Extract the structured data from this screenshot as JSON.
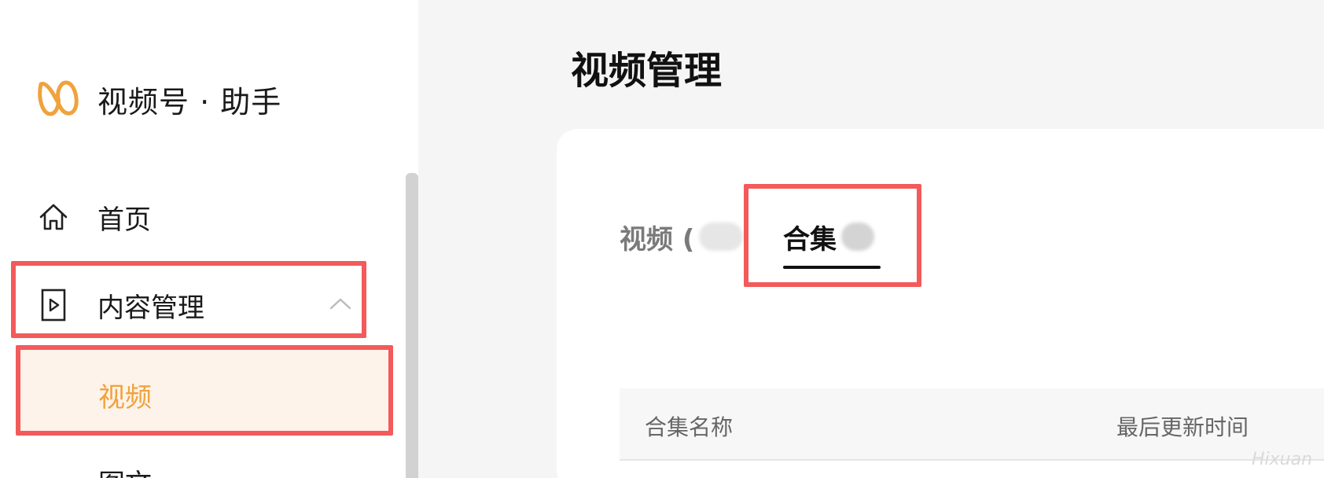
{
  "sidebar": {
    "logo_text": "视频号 · 助手",
    "logo_icon": "channels-logo-icon",
    "accent_color": "#f0a23d",
    "items": [
      {
        "label": "首页",
        "icon": "home-icon"
      },
      {
        "label": "内容管理",
        "icon": "play-document-icon",
        "expanded": true
      },
      {
        "label": "视频",
        "active": true
      },
      {
        "label": "图文"
      }
    ]
  },
  "main": {
    "page_title": "视频管理",
    "tabs": [
      {
        "label": "视频 (",
        "active": false
      },
      {
        "label": "合集",
        "active": true
      }
    ],
    "table": {
      "columns": [
        "合集名称",
        "最后更新时间"
      ]
    }
  },
  "highlight_color": "#f35a5a",
  "watermark": "Hixuan"
}
